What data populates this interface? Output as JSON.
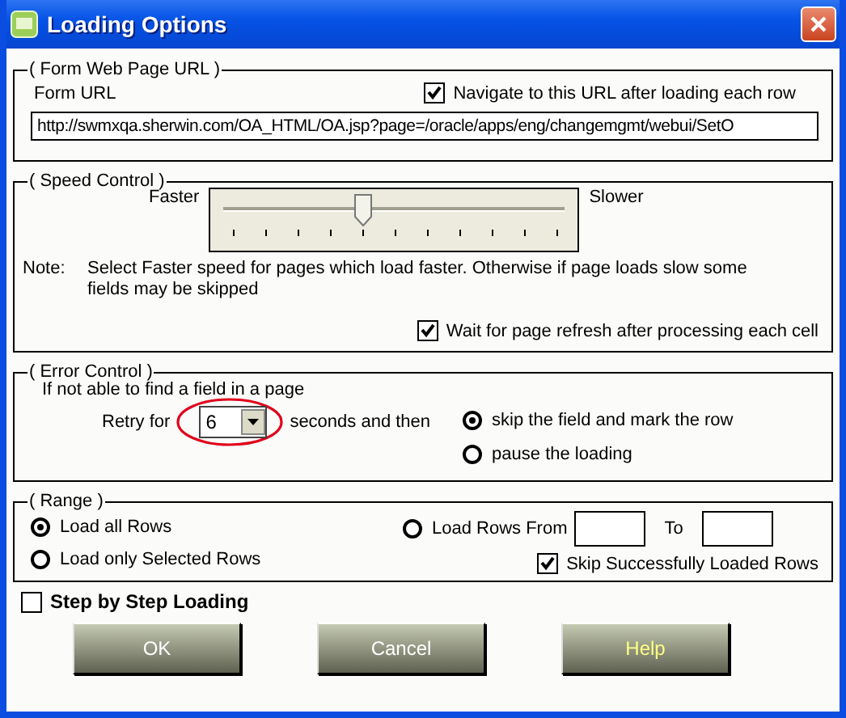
{
  "window": {
    "title": "Loading Options"
  },
  "form_url_group": {
    "title": "( Form Web Page URL )",
    "label": "Form URL",
    "navigate": {
      "label": "Navigate to this URL after loading each row",
      "checked": true
    },
    "url": "http://swmxqa.sherwin.com/OA_HTML/OA.jsp?page=/oracle/apps/eng/changemgmt/webui/SetO"
  },
  "speed_group": {
    "title": "( Speed Control )",
    "min_label": "Faster",
    "max_label": "Slower",
    "level": 0.4,
    "note_label": "Note:",
    "note": "Select Faster speed for pages which load faster. Otherwise if page loads slow some fields may be skipped",
    "wait": {
      "label": "Wait for page refresh after processing each cell",
      "checked": true
    }
  },
  "error_group": {
    "title": "( Error Control )",
    "intro": "If not able to find a field in a page",
    "retry_label": "Retry for",
    "retry_value": "6",
    "after_label": "seconds and then",
    "options": [
      {
        "label": "skip the field and mark the row",
        "selected": true
      },
      {
        "label": "pause the loading",
        "selected": false
      }
    ]
  },
  "range_group": {
    "title": "( Range )",
    "options": [
      {
        "label": "Load all Rows",
        "selected": true
      },
      {
        "label": "Load only Selected Rows",
        "selected": false
      },
      {
        "label": "Load Rows From",
        "selected": false
      }
    ],
    "to_label": "To",
    "skip": {
      "label": "Skip Successfully Loaded Rows",
      "checked": true
    }
  },
  "step_by_step": {
    "label": "Step by Step Loading",
    "checked": false
  },
  "buttons": [
    {
      "label": "OK",
      "emphasized": false
    },
    {
      "label": "Cancel",
      "emphasized": false
    },
    {
      "label": "Help",
      "emphasized": true
    }
  ]
}
